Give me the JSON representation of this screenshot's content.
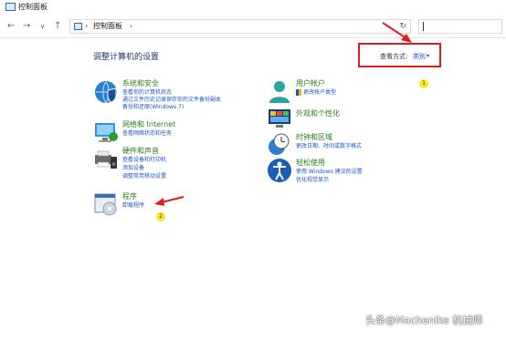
{
  "window": {
    "title": "控制面板"
  },
  "nav": {
    "back": "←",
    "forward": "→",
    "dropdown": "∨",
    "up": "↑",
    "breadcrumb_sep": "›",
    "breadcrumb": "控制面板",
    "breadcrumb_sep2": "›",
    "refresh": "↻"
  },
  "heading": "调整计算机的设置",
  "view_by": {
    "label": "查看方式:",
    "value": "类别",
    "arrow": "▾"
  },
  "categories": [
    {
      "title": "系统和安全",
      "icon": "shield-globe-icon",
      "links": [
        "查看你的计算机状态",
        "通过文件历史记录保存你的文件备份副本",
        "备份和还原(Windows 7)"
      ]
    },
    {
      "title": "网络和 Internet",
      "icon": "network-monitor-icon",
      "links": [
        "查看网络状态和任务"
      ]
    },
    {
      "title": "硬件和声音",
      "icon": "printer-speaker-icon",
      "links": [
        "查看设备和打印机",
        "添加设备",
        "调整常用移动设置"
      ]
    },
    {
      "title": "程序",
      "icon": "program-disc-icon",
      "links": [
        "卸载程序"
      ]
    },
    {
      "title": "用户帐户",
      "icon": "user-account-icon",
      "links": [
        "更改帐户类型"
      ]
    },
    {
      "title": "外观和个性化",
      "icon": "appearance-icon",
      "links": []
    },
    {
      "title": "时钟和区域",
      "icon": "clock-globe-icon",
      "links": [
        "更改日期、时间或数字格式"
      ]
    },
    {
      "title": "轻松使用",
      "icon": "accessibility-icon",
      "links": [
        "使用 Windows 建议的设置",
        "优化视觉显示"
      ]
    }
  ],
  "annotations": {
    "badge1": "1",
    "badge2": "2"
  },
  "watermark": "头条@Machenike 机械师",
  "colors": {
    "title_green": "#2d7d1e",
    "link_blue": "#1a56c4",
    "highlight_red": "#e21b1b",
    "badge_yellow": "#ffe923"
  }
}
